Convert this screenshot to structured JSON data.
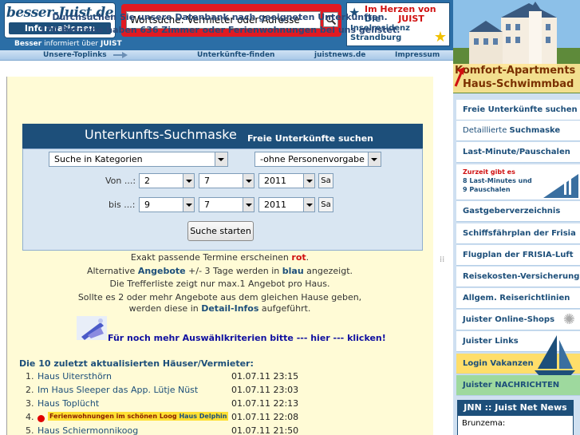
{
  "header": {
    "logo_top": "besser-Juist.de",
    "logo_bottom": "Informationen",
    "search_value": "Wortsuche: Vermieter oder Adresse",
    "promo": {
      "line1": "Im Herzen von",
      "line2": "Die",
      "line2b": "JUIST",
      "line3": "Inselresidenz",
      "line4": "Strandburg"
    },
    "tagline_bold1": "Besser",
    "tagline_mid": "informiert über",
    "tagline_bold2": "JUIST"
  },
  "nav": {
    "items": [
      "Unsere-Toplinks",
      "Unterkünfte-finden",
      "juistnews.de",
      "Impressum"
    ]
  },
  "sidebar": {
    "banner_line1": "Komfort-Apartments",
    "banner_line2": "Haus-Schwimmbad",
    "items": [
      "Freie Unterkünfte suchen",
      "Detaillierte Suchmaske",
      "Last-Minute/Pauschalen",
      "Gastgeberverzeichnis",
      "Schiffsfährplan der Frisia",
      "Flugplan der FRISIA-Luft",
      "Reisekosten-Versicherung",
      "Allgem. Reiserichtlinien",
      "Juister Online-Shops",
      "Juister Links",
      "Login Vakanzen",
      "Juister NACHRICHTEN"
    ],
    "detail_light": "Detaillierte",
    "detail_bold": "Suchmaske",
    "lastmin_lines": [
      "Zurzeit gibt es",
      "8 Last-Minutes und",
      "9 Pauschalen"
    ],
    "news_title": "JNN :: Juist Net News",
    "news_first": "Brunzema:"
  },
  "main": {
    "intro_line1": "Durchsuchen Sie unsere Datenbank nach geeigneten Unterkünften.",
    "intro_line2": "170 Betriebe haben 636 Zimmer oder Ferienwohnungen bei uns gelistet.",
    "mask_title": "Unterkunfts-Suchmaske",
    "mask_subtitle": "Freie Unterkünfte suchen",
    "category_select": "Suche in Kategorien",
    "persons_select": "-ohne Personenvorgabe -",
    "from_label": "Von ...:",
    "to_label": "bis ...:",
    "from": {
      "day": "2",
      "month": "7",
      "year": "2011"
    },
    "to": {
      "day": "9",
      "month": "7",
      "year": "2011"
    },
    "sa_label": "Sa",
    "start_button": "Suche starten",
    "info": {
      "l1_pre": "Exakt passende Termine erscheinen",
      "l1_red": "rot",
      "l1_post": ".",
      "l2_pre": "Alternative",
      "l2_blue1": "Angebote",
      "l2_mid": "+/- 3 Tage werden in",
      "l2_blue2": "blau",
      "l2_post": "angezeigt.",
      "l3": "Die Trefferliste zeigt nur max.1 Angebot pro Haus.",
      "l4": "Sollte es 2 oder mehr Angebote aus dem gleichen Hause geben,",
      "l5_pre": "werden diese in",
      "l5_bold": "Detail-Infos",
      "l5_post": "aufgeführt."
    },
    "more_link": "Für noch mehr Auswählkriterien bitte  --- hier ---  klicken!",
    "list_title": "Die 10 zuletzt aktualisierten Häuser/Vermieter:",
    "rows": [
      {
        "num": "1.",
        "name": "Haus Uitersthörn",
        "date": "01.07.11 23:15"
      },
      {
        "num": "2.",
        "name": "Im Haus Sleeper das App. Lütje Nüst",
        "date": "01.07.11 23:03"
      },
      {
        "num": "3.",
        "name": "Haus Toplücht",
        "date": "01.07.11 22:13"
      },
      {
        "num": "4.",
        "name": "Ferienwohnungen im schönen Loog",
        "name_bold": "Haus Delphin",
        "date": "01.07.11 22:08"
      },
      {
        "num": "5.",
        "name": "Haus Schiermonnikoog",
        "date": "01.07.11 21:50"
      }
    ]
  },
  "colors": {
    "brand_blue": "#1d4f7a",
    "accent_red": "#e01a22",
    "content_bg": "#fffbd6"
  }
}
